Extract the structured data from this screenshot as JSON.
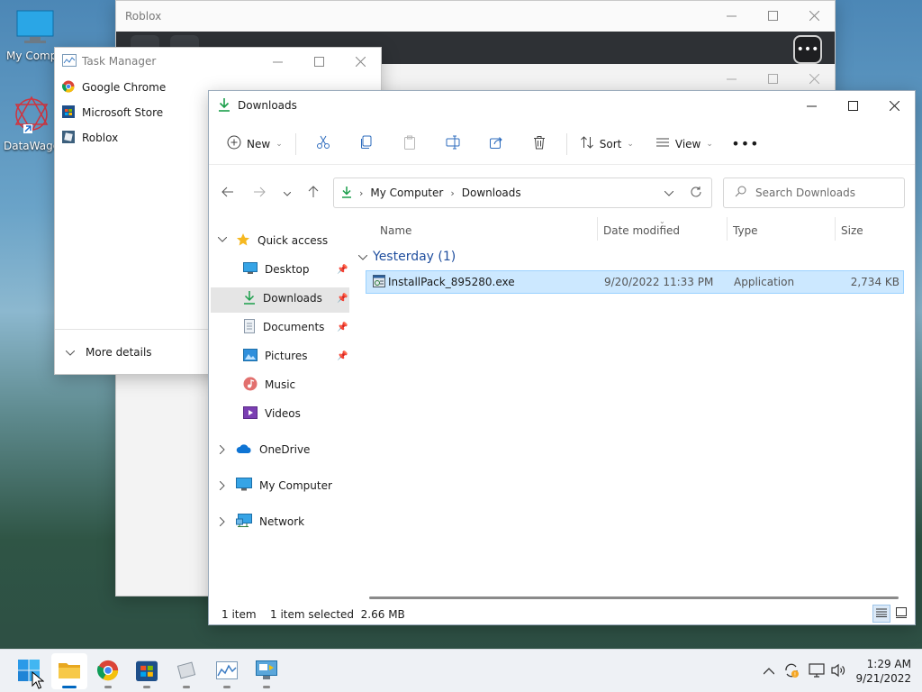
{
  "desktop": {
    "icons": [
      {
        "label": "My Compu"
      },
      {
        "label": "DataWago"
      }
    ]
  },
  "roblox": {
    "title": "Roblox",
    "menu_icon": "ellipsis-icon"
  },
  "task_manager": {
    "title": "Task Manager",
    "apps": [
      {
        "label": "Google Chrome",
        "icon": "chrome-icon"
      },
      {
        "label": "Microsoft Store",
        "icon": "store-icon"
      },
      {
        "label": "Roblox",
        "icon": "roblox-icon"
      }
    ],
    "more_details": "More details"
  },
  "explorer": {
    "title": "Downloads",
    "toolbar": {
      "new_label": "New",
      "sort_label": "Sort",
      "view_label": "View"
    },
    "breadcrumb": [
      "My Computer",
      "Downloads"
    ],
    "search_placeholder": "Search Downloads",
    "nav": {
      "quick_access": "Quick access",
      "quick_items": [
        {
          "label": "Desktop",
          "pinned": true
        },
        {
          "label": "Downloads",
          "pinned": true
        },
        {
          "label": "Documents",
          "pinned": true
        },
        {
          "label": "Pictures",
          "pinned": true
        },
        {
          "label": "Music",
          "pinned": false
        },
        {
          "label": "Videos",
          "pinned": false
        }
      ],
      "onedrive": "OneDrive",
      "my_computer": "My Computer",
      "network": "Network"
    },
    "columns": {
      "name": "Name",
      "date": "Date modified",
      "type": "Type",
      "size": "Size"
    },
    "group_label": "Yesterday (1)",
    "files": [
      {
        "name": "InstallPack_895280.exe",
        "date": "9/20/2022 11:33 PM",
        "type": "Application",
        "size": "2,734 KB"
      }
    ],
    "status": {
      "count": "1 item",
      "selected": "1 item selected  2.66 MB"
    }
  },
  "taskbar": {
    "time": "1:29 AM",
    "date": "9/21/2022"
  },
  "colors": {
    "accent": "#0067c0",
    "selection": "#cce8ff",
    "download_green": "#1a9e4a"
  }
}
